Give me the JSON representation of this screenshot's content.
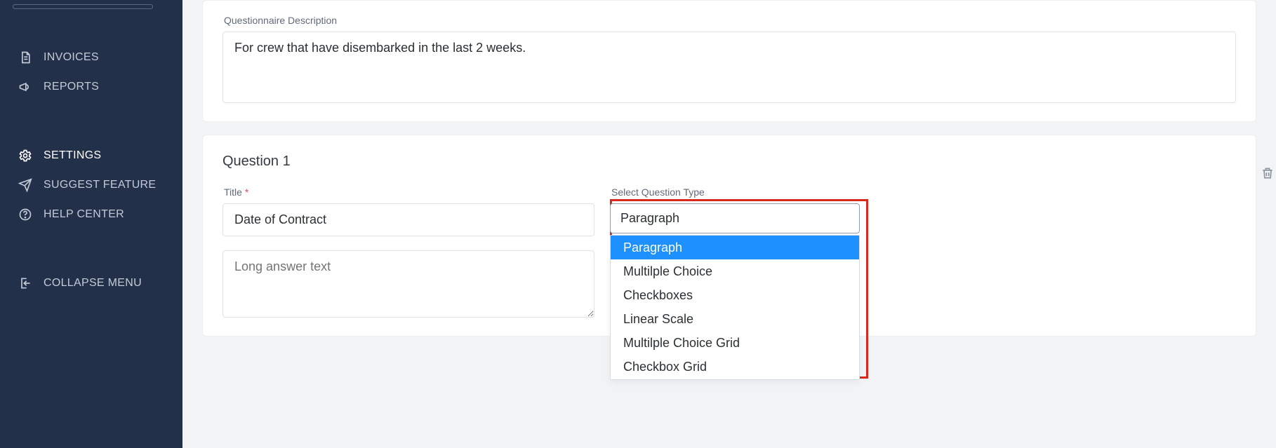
{
  "sidebar": {
    "items": [
      {
        "label": "INVOICES"
      },
      {
        "label": "REPORTS"
      },
      {
        "label": "SETTINGS"
      },
      {
        "label": "SUGGEST FEATURE"
      },
      {
        "label": "HELP CENTER"
      },
      {
        "label": "COLLAPSE MENU"
      }
    ]
  },
  "desc": {
    "label": "Questionnaire Description",
    "value": "For crew that have disembarked in the last 2 weeks."
  },
  "question": {
    "header": "Question 1",
    "title_label": "Title",
    "title_required_mark": "*",
    "title_value": "Date of Contract",
    "answer_placeholder": "Long answer text",
    "type_label": "Select Question Type",
    "type_selected": "Paragraph",
    "type_options": [
      "Paragraph",
      "Multilple Choice",
      "Checkboxes",
      "Linear Scale",
      "Multilple Choice Grid",
      "Checkbox Grid"
    ]
  }
}
